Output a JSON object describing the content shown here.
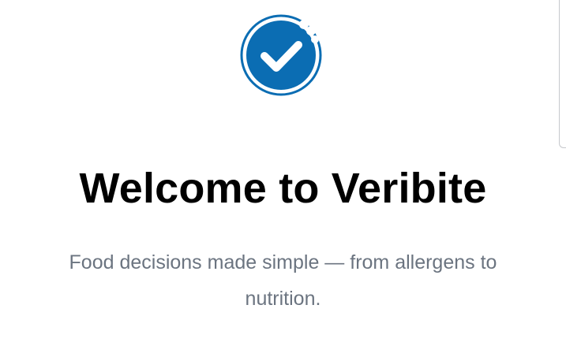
{
  "brand": {
    "accent_color": "#0b6db3",
    "logo_icon": "bitten-check-badge-icon"
  },
  "welcome": {
    "title": "Welcome to Veribite",
    "subtitle": "Food decisions made simple — from allergens to nutrition."
  }
}
